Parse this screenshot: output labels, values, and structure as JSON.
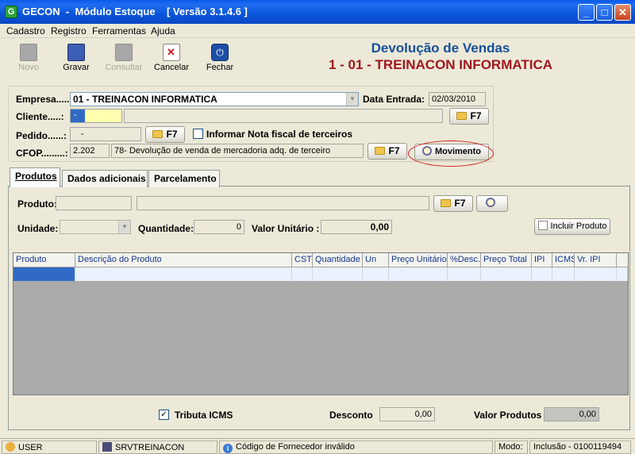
{
  "window": {
    "app_icon": "G",
    "title": "GECON  -  Módulo Estoque    [ Versão 3.1.4.6 ]",
    "minimize": "_",
    "maximize": "□",
    "close": "✕"
  },
  "menu": [
    "Cadastro",
    "Registro",
    "Ferramentas",
    "Ajuda"
  ],
  "toolbar": {
    "novo": "Novo",
    "gravar": "Gravar",
    "consultar": "Consultar",
    "cancelar": "Cancelar",
    "fechar": "Fechar"
  },
  "header": {
    "title": "Devolução de Vendas",
    "company": "1 - 01 - TREINACON INFORMATICA"
  },
  "form": {
    "empresa_label": "Empresa.....:",
    "empresa_value": "01 - TREINACON INFORMATICA",
    "data_entrada_label": "Data Entrada:",
    "data_entrada_value": "02/03/2010",
    "cliente_label": "Cliente.....:",
    "cliente_code": "-",
    "cliente_name": "",
    "pedido_label": "Pedido......:",
    "pedido_value": "-",
    "f7": "F7",
    "informar_label": "Informar Nota fiscal de terceiros",
    "cfop_label": "CFOP.........:",
    "cfop_code": "2.202",
    "cfop_desc": "78- Devolução de venda de mercadoria adq. de terceiro",
    "movimento": "Movimento"
  },
  "tabs": [
    "Produtos",
    "Dados adicionais",
    "Parcelamento"
  ],
  "produtos": {
    "produto_label": "Produto:",
    "produto_code": "",
    "produto_desc": "",
    "unidade_label": "Unidade:",
    "quantidade_label": "Quantidade:",
    "quantidade_value": "0",
    "valor_unitario_label": "Valor Unitário :",
    "valor_unitario_value": "0,00",
    "incluir": "Incluir Produto"
  },
  "grid": {
    "columns": [
      "Produto",
      "Descrição do Produto",
      "CST",
      "Quantidade",
      "Un",
      "Preço Unitário",
      "%Desc.",
      "Preço Total",
      "IPI",
      "ICMS",
      "Vr. IPI"
    ]
  },
  "footer": {
    "tributa_label": "Tributa ICMS",
    "tributa_check": "✓",
    "desconto_label": "Desconto",
    "desconto_value": "0,00",
    "valor_produtos_label": "Valor Produtos",
    "valor_produtos_value": "0,00"
  },
  "status": {
    "user": "USER",
    "server": "SRVTREINACON",
    "message": "Código de Fornecedor inválido",
    "modo_label": "Modo:",
    "modo_value": "Inclusão - 0100119494"
  },
  "colors": {
    "title_blue": "#14509a",
    "company_red": "#a1161f",
    "selection_blue": "#316ac5",
    "highlight_red": "#d02020"
  }
}
